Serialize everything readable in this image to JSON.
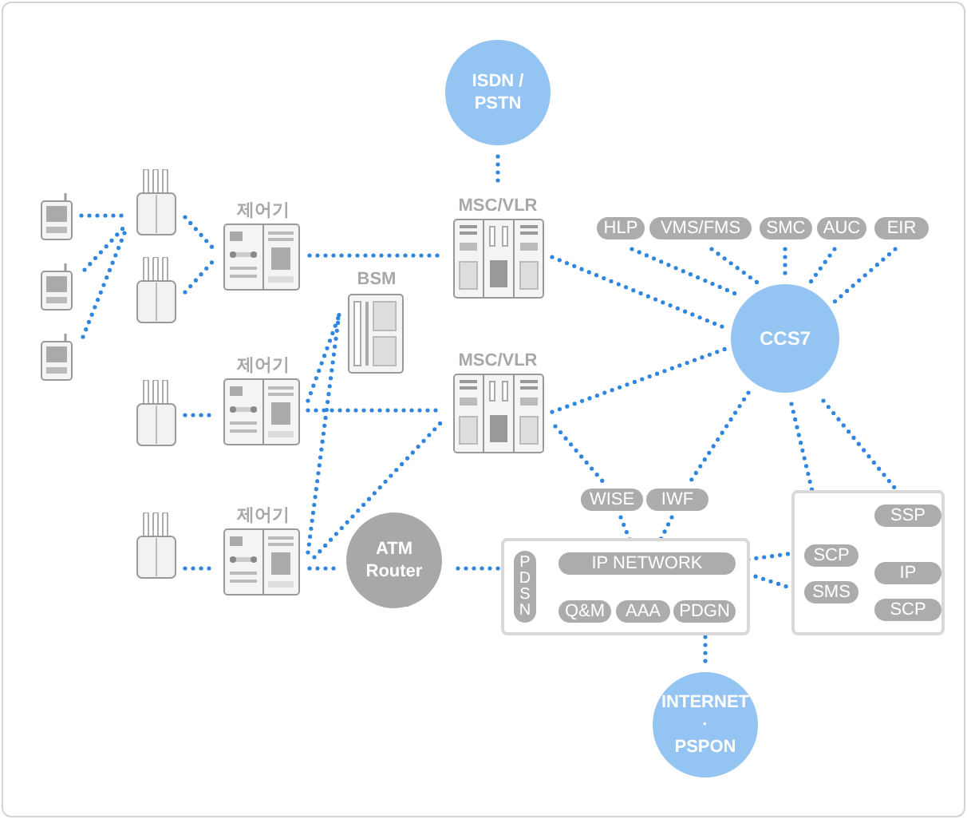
{
  "networks": [
    {
      "lines": [
        "ISDN /",
        "PSTN"
      ]
    },
    {
      "lines": [
        "CCS7"
      ]
    },
    {
      "lines": [
        "INTERNET",
        "·",
        "PSPON"
      ]
    }
  ],
  "atm_router": {
    "lines": [
      "ATM",
      "Router"
    ]
  },
  "controllers": [
    {
      "label": "제어기"
    },
    {
      "label": "제어기"
    },
    {
      "label": "제어기"
    }
  ],
  "bsm": {
    "label": "BSM"
  },
  "msc_vlr": [
    {
      "label": "MSC/VLR"
    },
    {
      "label": "MSC/VLR"
    }
  ],
  "ccs7_services": [
    "HLP",
    "VMS/FMS",
    "SMC",
    "AUC",
    "EIR"
  ],
  "gateways": [
    "WISE",
    "IWF"
  ],
  "pdsn": {
    "label": "PDSN",
    "network": "IP NETWORK",
    "services": [
      "Q&M",
      "AAA",
      "PDGN"
    ]
  },
  "intelligent_network": [
    "SSP",
    "SCP",
    "IP",
    "SMS",
    "SCP"
  ]
}
